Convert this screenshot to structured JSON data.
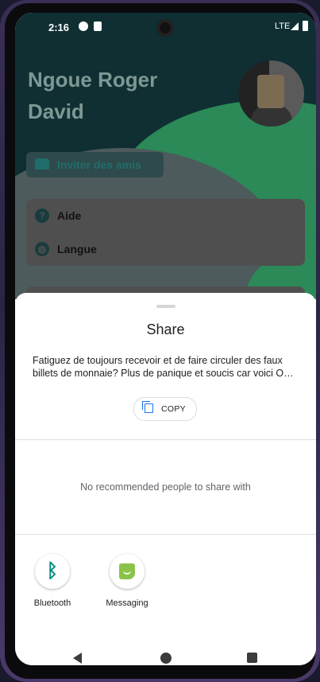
{
  "status_bar": {
    "time": "2:16",
    "network": "LTE"
  },
  "profile": {
    "name_line1": "Ngoue Roger",
    "name_line2": "David",
    "invite_label": "Inviter des amis"
  },
  "menu": {
    "items": [
      {
        "label": "Aide",
        "icon": "help-circle-icon"
      },
      {
        "label": "Langue",
        "icon": "globe-icon"
      }
    ]
  },
  "share_sheet": {
    "title": "Share",
    "text_line1": "Fatiguez de toujours recevoir et de faire circuler des faux",
    "text_line2": "billets de monnaie? Plus de panique et soucis car voici O…",
    "copy_label": "COPY",
    "no_recommended": "No recommended people to share with",
    "targets": [
      {
        "label": "Bluetooth",
        "icon": "bluetooth-icon"
      },
      {
        "label": "Messaging",
        "icon": "messaging-icon"
      }
    ]
  },
  "colors": {
    "accent_teal": "#00897b",
    "messaging_green": "#8bc34a",
    "copy_blue": "#1a73e8"
  }
}
